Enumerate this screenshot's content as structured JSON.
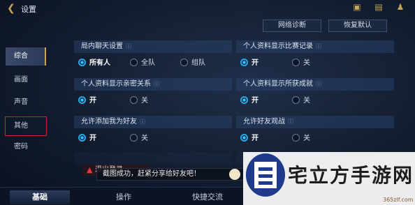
{
  "header": {
    "title": "设置",
    "icons": [
      "clipboard-icon",
      "chat-icon",
      "friends-icon"
    ]
  },
  "top_buttons": {
    "network": "网络诊断",
    "reset": "恢复默认"
  },
  "sidebar": {
    "items": [
      {
        "label": "综合",
        "active": true
      },
      {
        "label": "画面"
      },
      {
        "label": "声音"
      },
      {
        "label": "其他",
        "highlight": true
      },
      {
        "label": "密码"
      }
    ]
  },
  "settings": {
    "chat": {
      "title": "局内聊天设置",
      "options": [
        "所有人",
        "全队",
        "组队"
      ],
      "selected": "所有人"
    },
    "show_record": {
      "title": "个人资料显示比赛记录",
      "on": "开",
      "off": "关",
      "selected": "开"
    },
    "show_intimacy": {
      "title": "个人资料显示亲密关系",
      "on": "开",
      "off": "关",
      "selected": "开"
    },
    "show_achievements": {
      "title": "个人资料显示所获成就",
      "on": "开",
      "off": "关",
      "selected": "开"
    },
    "allow_friend": {
      "title": "允许添加我为好友",
      "on": "开",
      "off": "关",
      "selected": "开"
    },
    "allow_watch": {
      "title": "允许好友观战",
      "on": "开",
      "off": "关",
      "selected": "开"
    }
  },
  "logout": "退出登录",
  "toast": "截图成功，赶紧分享给好友吧！",
  "bottom_tabs": [
    {
      "label": "基础",
      "active": true
    },
    {
      "label": "操作"
    },
    {
      "label": "快捷交流"
    }
  ],
  "watermark": {
    "text": "宅立方手游网",
    "url": "365zlf.com"
  }
}
